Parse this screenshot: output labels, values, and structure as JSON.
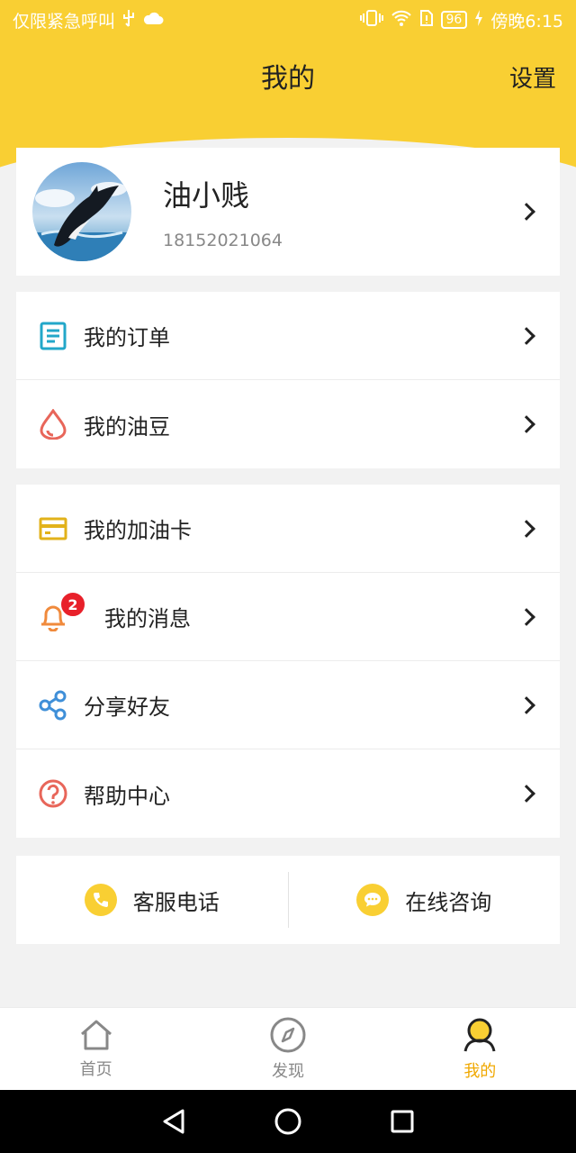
{
  "status_bar": {
    "left_text": "仅限紧急呼叫",
    "battery": "96",
    "time": "傍晚6:15"
  },
  "header": {
    "title": "我的",
    "settings_label": "设置"
  },
  "profile": {
    "name": "油小贱",
    "phone": "18152021064"
  },
  "menu_group_1": [
    {
      "label": "我的订单",
      "icon": "order-list-icon"
    },
    {
      "label": "我的油豆",
      "icon": "oil-drop-icon"
    }
  ],
  "menu_group_2": [
    {
      "label": "我的加油卡",
      "icon": "card-icon"
    },
    {
      "label": "我的消息",
      "icon": "bell-icon",
      "badge": "2"
    },
    {
      "label": "分享好友",
      "icon": "share-icon"
    },
    {
      "label": "帮助中心",
      "icon": "help-icon"
    }
  ],
  "contact": {
    "phone_label": "客服电话",
    "chat_label": "在线咨询"
  },
  "tabs": [
    {
      "label": "首页",
      "icon": "home-icon"
    },
    {
      "label": "发现",
      "icon": "compass-icon"
    },
    {
      "label": "我的",
      "icon": "profile-icon",
      "active": true
    }
  ],
  "colors": {
    "brand_yellow": "#f9cf33",
    "active_tab": "#f0a800",
    "badge_red": "#e8202a"
  }
}
